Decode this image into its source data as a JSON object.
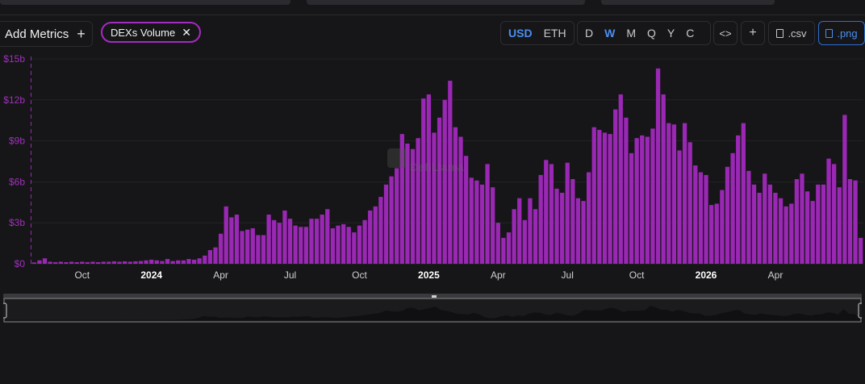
{
  "toolbar": {
    "add_metrics_label": "Add Metrics",
    "metric_pill_label": "DEXs Volume",
    "currency_options": [
      "USD",
      "ETH"
    ],
    "currency_selected": "USD",
    "period_options": [
      "D",
      "W",
      "M",
      "Q",
      "Y",
      "C"
    ],
    "period_selected": "W",
    "embed_label": "<>",
    "add_label": "+",
    "csv_label": ".csv",
    "png_label": ".png"
  },
  "watermark": "DefiLlama",
  "colors": {
    "bar": "#9b27b5",
    "accent": "#4a8ef0",
    "pill_border": "#a32bbf",
    "background": "#161618"
  },
  "chart_data": {
    "type": "bar",
    "ylim": [
      0,
      15
    ],
    "y_ticks": [
      0,
      3,
      6,
      9,
      12,
      15
    ],
    "y_tick_labels": [
      "$0",
      "$3b",
      "$6b",
      "$9b",
      "$12b",
      "$15b"
    ],
    "x_ticks": [
      {
        "label": "Oct",
        "bar_index": 9,
        "bold": false
      },
      {
        "label": "2024",
        "bar_index": 22,
        "bold": true
      },
      {
        "label": "Apr",
        "bar_index": 35,
        "bold": false
      },
      {
        "label": "Jul",
        "bar_index": 48,
        "bold": false
      },
      {
        "label": "Oct",
        "bar_index": 61,
        "bold": false
      },
      {
        "label": "2025",
        "bar_index": 74,
        "bold": true
      },
      {
        "label": "Apr",
        "bar_index": 87,
        "bold": false
      },
      {
        "label": "Jul",
        "bar_index": 100,
        "bold": false
      },
      {
        "label": "Oct",
        "bar_index": 113,
        "bold": false
      },
      {
        "label": "2026",
        "bar_index": 126,
        "bold": true
      },
      {
        "label": "Apr",
        "bar_index": 139,
        "bold": false
      }
    ],
    "values": [
      0.1,
      0.25,
      0.4,
      0.15,
      0.12,
      0.15,
      0.12,
      0.15,
      0.12,
      0.15,
      0.12,
      0.15,
      0.12,
      0.15,
      0.15,
      0.18,
      0.15,
      0.18,
      0.15,
      0.18,
      0.2,
      0.25,
      0.3,
      0.25,
      0.2,
      0.35,
      0.2,
      0.25,
      0.25,
      0.35,
      0.3,
      0.4,
      0.6,
      1.0,
      1.2,
      2.2,
      4.2,
      3.4,
      3.6,
      2.4,
      2.5,
      2.6,
      2.1,
      2.1,
      3.6,
      3.2,
      3.0,
      3.9,
      3.3,
      2.8,
      2.7,
      2.7,
      3.3,
      3.3,
      3.6,
      4.0,
      2.6,
      2.8,
      2.9,
      2.7,
      2.3,
      2.8,
      3.2,
      3.9,
      4.2,
      4.9,
      5.8,
      6.4,
      7.0,
      9.5,
      8.8,
      8.4,
      9.2,
      12.1,
      12.4,
      9.6,
      10.7,
      12.0,
      13.4,
      10.0,
      9.3,
      7.9,
      6.3,
      6.1,
      5.8,
      7.3,
      5.6,
      3.0,
      1.9,
      2.3,
      4.0,
      4.8,
      3.2,
      4.8,
      4.0,
      6.5,
      7.6,
      7.3,
      5.5,
      5.2,
      7.4,
      6.2,
      4.8,
      4.6,
      6.7,
      10.0,
      9.8,
      9.6,
      9.5,
      11.3,
      12.4,
      10.7,
      8.1,
      9.2,
      9.4,
      9.3,
      9.9,
      14.3,
      12.4,
      10.3,
      10.2,
      8.3,
      10.3,
      8.9,
      7.2,
      6.7,
      6.5,
      4.3,
      4.4,
      5.4,
      7.1,
      8.1,
      9.4,
      10.3,
      6.8,
      5.8,
      5.2,
      6.6,
      5.8,
      5.2,
      4.8,
      4.2,
      4.4,
      6.2,
      6.6,
      5.3,
      4.6,
      5.8,
      5.8,
      7.7,
      7.3,
      5.6,
      10.9,
      6.2,
      6.1,
      1.9
    ]
  }
}
